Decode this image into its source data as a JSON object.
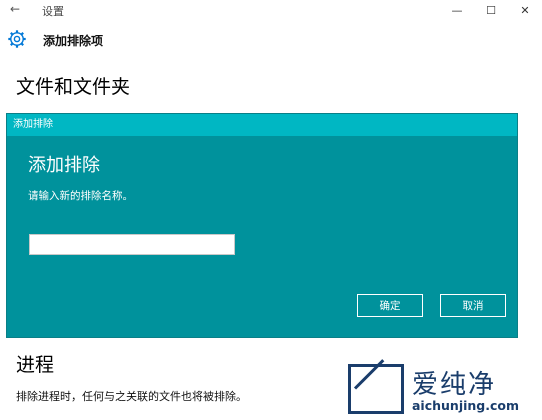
{
  "window": {
    "back_glyph": "←",
    "title": "设置",
    "minimize_glyph": "—",
    "maximize_glyph": "☐",
    "close_glyph": "✕"
  },
  "header": {
    "icon": "gear-icon",
    "title": "添加排除项"
  },
  "sections": {
    "files_title": "文件和文件夹",
    "process_title": "进程",
    "process_desc": "排除进程时，任何与之关联的文件也将被排除。"
  },
  "dialog": {
    "caption": "添加排除",
    "heading": "添加排除",
    "prompt": "请输入新的排除名称。",
    "input_value": "",
    "ok_label": "确定",
    "cancel_label": "取消"
  },
  "watermark": {
    "title": "爱纯净",
    "url": "aichunjing.com"
  },
  "colors": {
    "dialog_bg": "#00929c",
    "dialog_caption": "#00b7c3",
    "accent": "#0078d7",
    "watermark": "#1a3d6b"
  }
}
